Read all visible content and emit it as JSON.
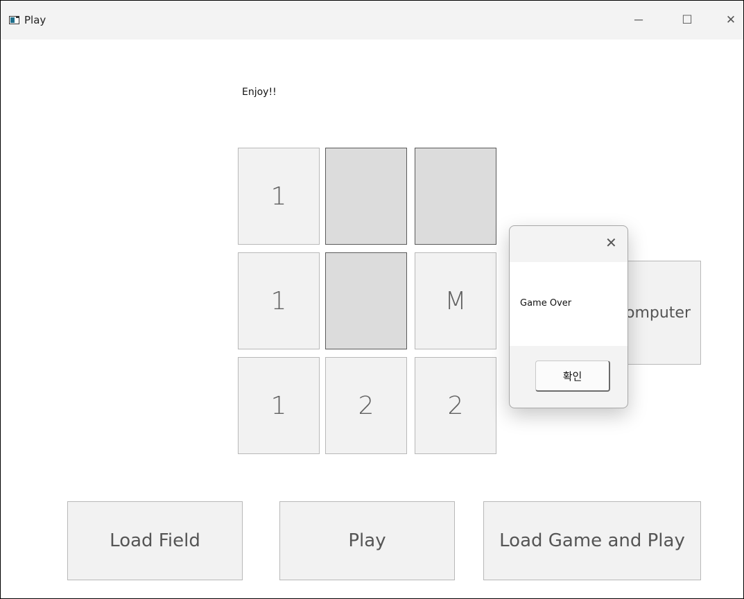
{
  "window": {
    "title": "Play",
    "minimize_glyph": "─",
    "maximize_glyph": "☐",
    "close_glyph": "✕"
  },
  "status_message": "Enjoy!!",
  "grid": [
    [
      "1",
      "",
      ""
    ],
    [
      "1",
      "",
      "M"
    ],
    [
      "1",
      "2",
      "2"
    ]
  ],
  "grid_covered": [
    [
      false,
      true,
      true
    ],
    [
      false,
      true,
      false
    ],
    [
      false,
      false,
      false
    ]
  ],
  "side_button": {
    "label": "Computer"
  },
  "bottom_buttons": {
    "load_field": "Load Field",
    "play": "Play",
    "load_game_and_play": "Load Game and Play"
  },
  "dialog": {
    "message": "Game Over",
    "ok_label": "확인",
    "close_glyph": "✕"
  }
}
